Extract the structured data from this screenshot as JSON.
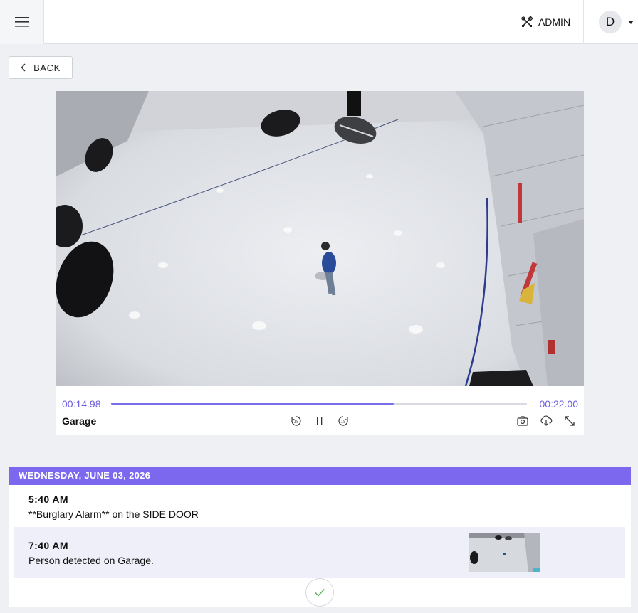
{
  "header": {
    "admin_label": "ADMIN",
    "user_initial": "D"
  },
  "nav": {
    "back_label": "BACK"
  },
  "player": {
    "current_time": "00:14.98",
    "total_time": "00:22.00",
    "progress": 0.68,
    "camera_name": "Garage",
    "controls": [
      "rewind-15-icon",
      "pause-icon",
      "forward-15-icon",
      "snapshot-icon",
      "download-icon",
      "fullscreen-icon"
    ]
  },
  "timeline": {
    "date_header": "WEDNESDAY, JUNE 03, 2026",
    "events": [
      {
        "time": "5:40 AM",
        "description": "**Burglary Alarm** on the SIDE DOOR"
      },
      {
        "time": "7:40 AM",
        "description": "Person detected on Garage."
      }
    ]
  },
  "colors": {
    "accent": "#7b68ee",
    "time_text": "#6c5fe0",
    "page_bg": "#eef0f4"
  }
}
